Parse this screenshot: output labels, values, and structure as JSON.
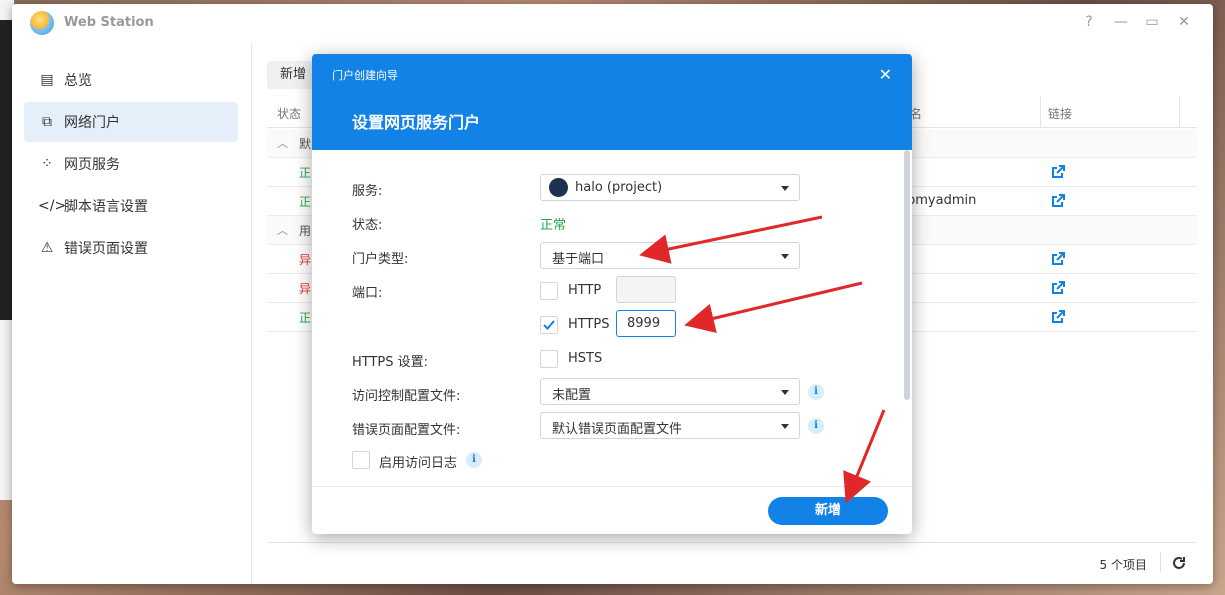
{
  "window": {
    "title": "Web Station",
    "controls": {
      "help": "?",
      "minimize": "—",
      "maximize": "▭",
      "close": "✕"
    }
  },
  "sidebar": {
    "items": [
      {
        "label": "总览",
        "icon": "overview-icon"
      },
      {
        "label": "网络门户",
        "icon": "portal-icon",
        "active": true
      },
      {
        "label": "网页服务",
        "icon": "web-service-icon"
      },
      {
        "label": "脚本语言设置",
        "icon": "code-icon"
      },
      {
        "label": "错误页面设置",
        "icon": "error-page-icon"
      }
    ]
  },
  "toolbar": {
    "create_label": "新增"
  },
  "table": {
    "headers": {
      "status": "状态",
      "name": "名",
      "link": "链接"
    },
    "groups": [
      {
        "label": "默"
      },
      {
        "label": "用"
      }
    ],
    "rows": [
      {
        "status": "正",
        "name": "",
        "status_type": "ok"
      },
      {
        "status": "正",
        "name": "pmyadmin",
        "status_type": "ok"
      },
      {
        "status": "异",
        "name": "",
        "status_type": "error"
      },
      {
        "status": "异",
        "name": "",
        "status_type": "error"
      },
      {
        "status": "正",
        "name": "",
        "status_type": "ok"
      }
    ]
  },
  "footer": {
    "count_text": "5 个项目"
  },
  "dialog": {
    "small_title": "门户创建向导",
    "title": "设置网页服务门户",
    "close": "✕",
    "fields": {
      "service_label": "服务:",
      "service_value": "halo (project)",
      "status_label": "状态:",
      "status_value": "正常",
      "portal_type_label": "门户类型:",
      "portal_type_value": "基于端口",
      "port_label": "端口:",
      "http_label": "HTTP",
      "https_label": "HTTPS",
      "https_port": "8999",
      "https_settings_label": "HTTPS 设置:",
      "hsts_label": "HSTS",
      "access_control_label": "访问控制配置文件:",
      "access_control_value": "未配置",
      "error_page_label": "错误页面配置文件:",
      "error_page_value": "默认错误页面配置文件",
      "access_log_label": "启用访问日志"
    },
    "create_button": "新增"
  },
  "colors": {
    "accent": "#1282e6",
    "ok": "#28a745",
    "error": "#e03a3a",
    "annotation": "#e0282a"
  }
}
